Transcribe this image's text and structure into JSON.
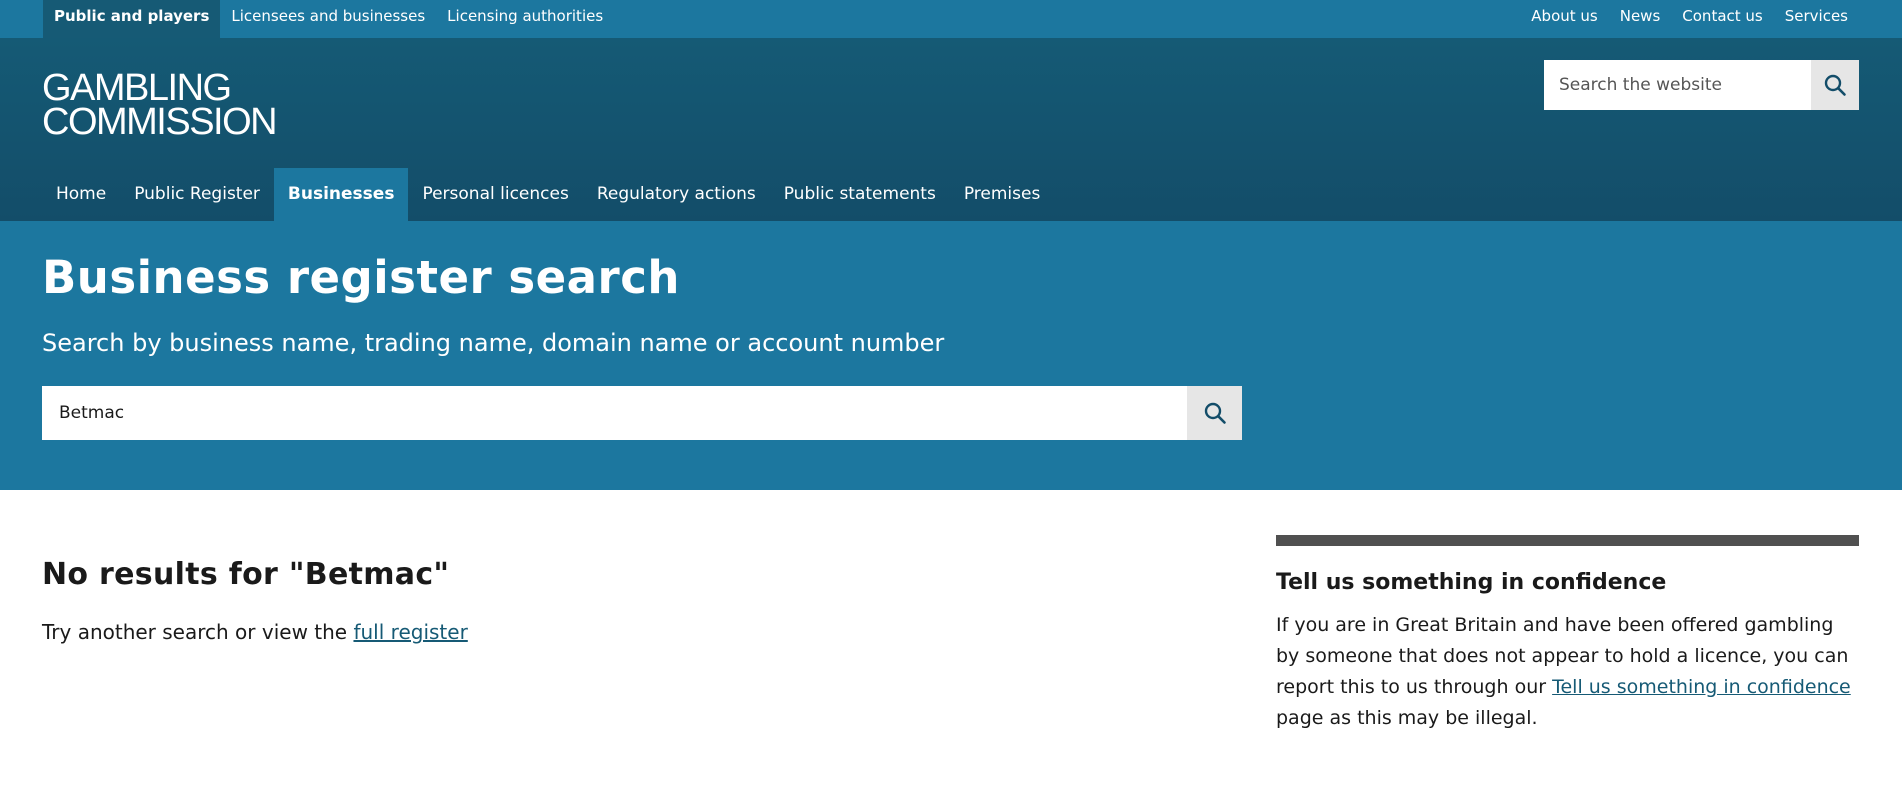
{
  "topbar": {
    "audience": [
      {
        "label": "Public and players",
        "active": true
      },
      {
        "label": "Licensees and businesses",
        "active": false
      },
      {
        "label": "Licensing authorities",
        "active": false
      }
    ],
    "utility": [
      {
        "label": "About us"
      },
      {
        "label": "News"
      },
      {
        "label": "Contact us"
      },
      {
        "label": "Services"
      }
    ]
  },
  "header": {
    "logo_line1": "GAMBLING",
    "logo_line2": "COMMISSION",
    "search": {
      "placeholder": "Search the website",
      "icon": "search-icon"
    }
  },
  "nav": {
    "items": [
      {
        "label": "Home",
        "active": false
      },
      {
        "label": "Public Register",
        "active": false
      },
      {
        "label": "Businesses",
        "active": true
      },
      {
        "label": "Personal licences",
        "active": false
      },
      {
        "label": "Regulatory actions",
        "active": false
      },
      {
        "label": "Public statements",
        "active": false
      },
      {
        "label": "Premises",
        "active": false
      }
    ]
  },
  "hero": {
    "title": "Business register search",
    "subtitle": "Search by business name, trading name, domain name or account number",
    "search_value": "Betmac"
  },
  "results": {
    "heading": "No results for \"Betmac\"",
    "text_before": "Try another search or view the ",
    "link": "full register"
  },
  "aside": {
    "heading": "Tell us something in confidence",
    "text_before": "If you are in Great Britain and have been offered gambling by someone that does not appear to hold a licence, you can report this to us through our ",
    "link": "Tell us something in confidence",
    "text_after": " page as this may be illegal."
  },
  "colors": {
    "topbar": "#1c779f",
    "header": "#155a75",
    "hero": "#1c779f",
    "link": "#165a75",
    "aside_rule": "#505050"
  }
}
